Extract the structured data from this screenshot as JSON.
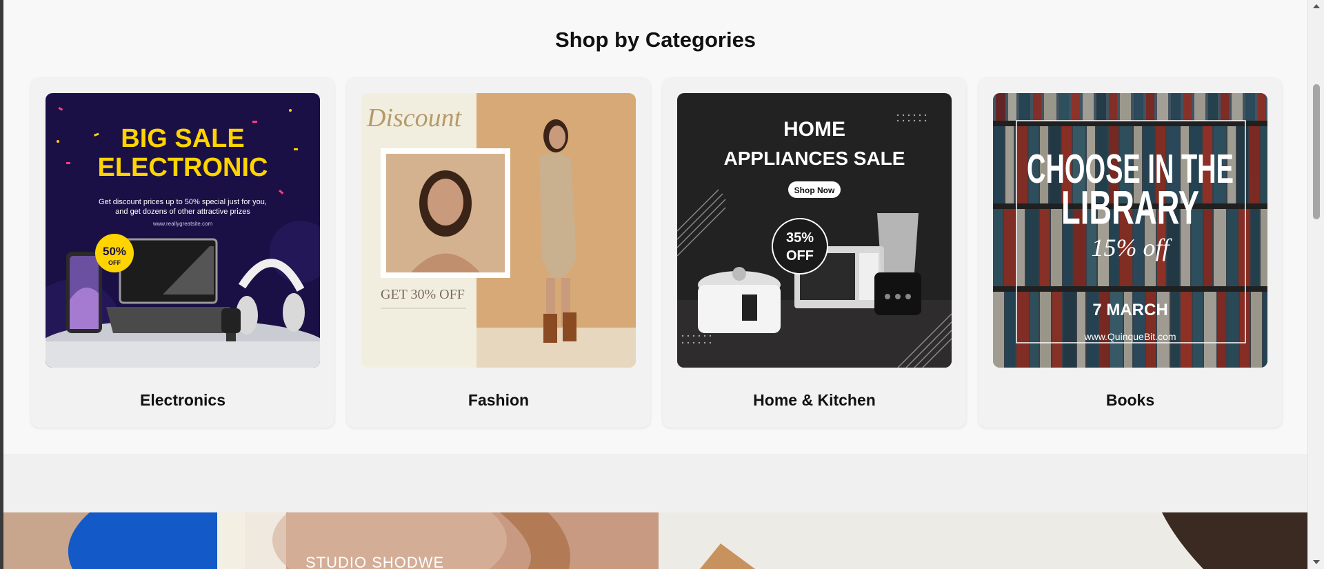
{
  "section": {
    "title": "Shop by Categories"
  },
  "categories": [
    {
      "label": "Electronics",
      "image": {
        "headline_1": "BIG SALE",
        "headline_2": "ELECTRONIC",
        "line_1": "Get discount prices up to 50% special just for you,",
        "line_2": "and get dozens of other attractive prizes",
        "url": "www.reallygreatsite.com",
        "badge_1": "50%",
        "badge_2": "OFF"
      }
    },
    {
      "label": "Fashion",
      "image": {
        "script": "Discount",
        "offer": "GET 30% OFF"
      }
    },
    {
      "label": "Home & Kitchen",
      "image": {
        "headline_1": "HOME",
        "headline_2": "APPLIANCES SALE",
        "cta": "Shop Now",
        "badge_1": "35%",
        "badge_2": "OFF"
      }
    },
    {
      "label": "Books",
      "image": {
        "headline_1": "CHOOSE IN THE",
        "headline_2": "LIBRARY",
        "script": "15% off",
        "date": "7 MARCH",
        "url": "www.QuinqueBit.com"
      }
    }
  ],
  "banner": {
    "text": "STUDIO SHODWE"
  },
  "colors": {
    "page_bg": "#f8f8f8",
    "card_bg": "#f2f2f2",
    "electronics_bg": "#1b1046",
    "electronics_accent": "#ffd400",
    "fashion_cream": "#f2eedf",
    "fashion_tan": "#d6a977",
    "home_bg": "#232222",
    "books_bg": "#4a5560"
  },
  "icons": [
    "scroll-up-arrow-icon",
    "scroll-down-arrow-icon"
  ]
}
